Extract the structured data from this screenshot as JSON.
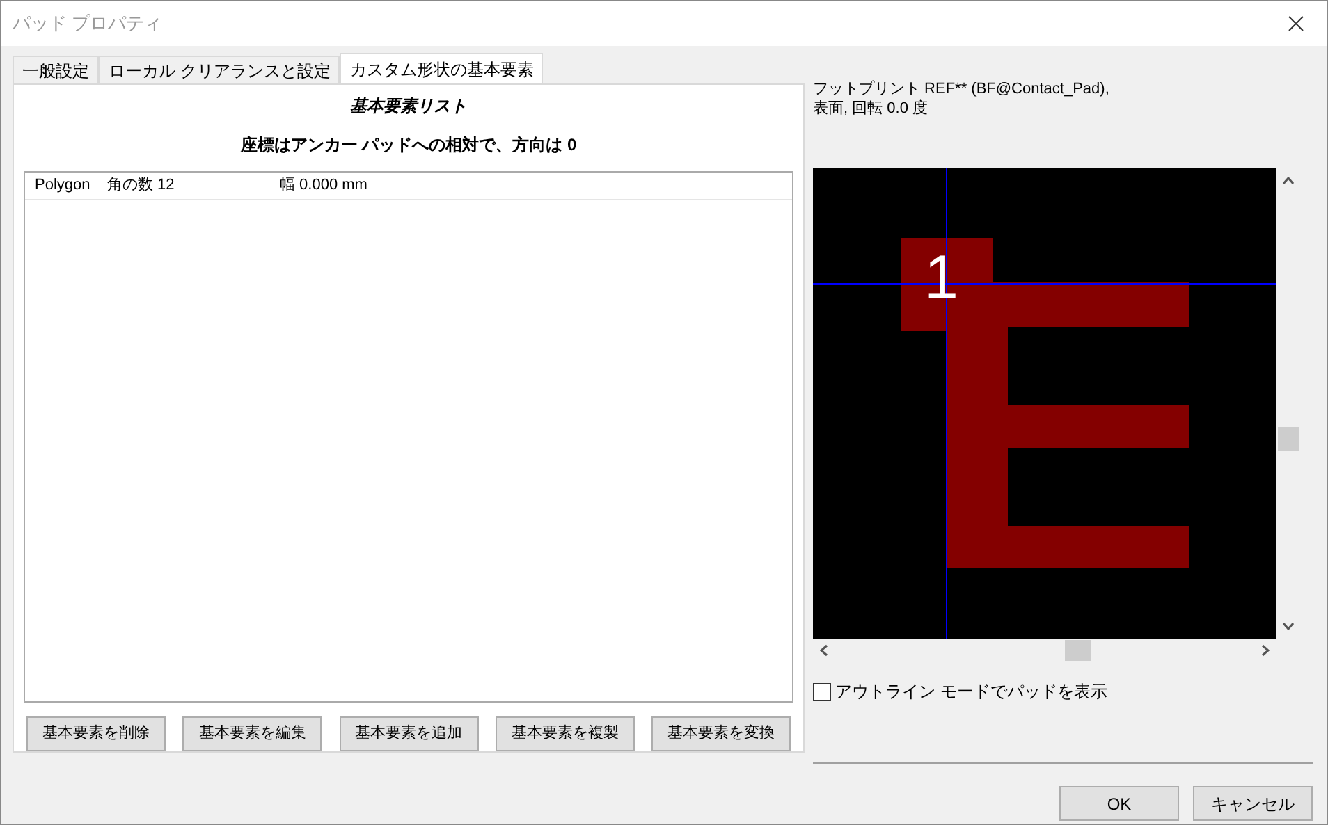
{
  "window": {
    "title": "パッド プロパティ"
  },
  "tabs": [
    {
      "label": "一般設定",
      "selected": false
    },
    {
      "label": "ローカル クリアランスと設定",
      "selected": false
    },
    {
      "label": "カスタム形状の基本要素",
      "selected": true
    }
  ],
  "list_title": "基本要素リスト",
  "list_note": "座標はアンカー パッドへの相対で、方向は 0",
  "primitives": [
    {
      "type": "Polygon",
      "corners": "角の数 12",
      "width": "幅 0.000 mm",
      "selected": false
    }
  ],
  "primitive_buttons": [
    "基本要素を削除",
    "基本要素を編集",
    "基本要素を追加",
    "基本要素を複製",
    "基本要素を変換"
  ],
  "footprint_info": [
    "フットプリント REF** (BF@Contact_Pad),",
    "表面, 回転 0.0 度"
  ],
  "preview": {
    "pad_number": "1"
  },
  "outline_mode": {
    "label": "アウトライン モードでパッドを表示",
    "checked": false
  },
  "buttons": [
    "OK",
    "キャンセル"
  ]
}
